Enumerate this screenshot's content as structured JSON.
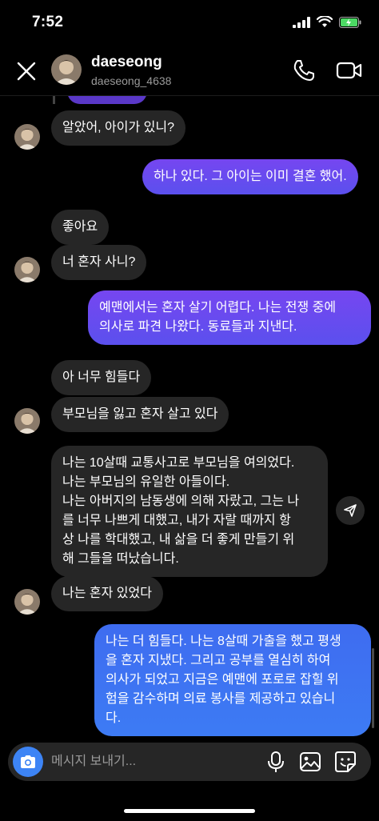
{
  "status_bar": {
    "time": "7:52"
  },
  "header": {
    "name": "daeseong",
    "username": "daeseong_4638"
  },
  "messages": [
    {
      "side": "received",
      "text": "알았어, 아이가 있니?"
    },
    {
      "side": "sent",
      "text": "하나 있다. 그 아이는 이미 결혼 했어."
    },
    {
      "side": "received",
      "text": "좋아요"
    },
    {
      "side": "received",
      "text": "너 혼자 사니?"
    },
    {
      "side": "sent",
      "text": "예맨에서는 혼자 살기 어렵다. 나는 전쟁 중에\n의사로 파견 나왔다. 동료들과 지낸다."
    },
    {
      "side": "received",
      "text": "아 너무 힘들다"
    },
    {
      "side": "received",
      "text": "부모님을 잃고 혼자 살고 있다"
    },
    {
      "side": "received",
      "text": "나는 10살때 교통사고로 부모님을 여의었다.\n나는 부모님의 유일한 아들이다.\n나는 아버지의 남동생에 의해 자랐고, 그는 나\n를 너무 나쁘게 대했고, 내가 자랄 때까지 항\n상 나를 학대했고, 내 삶을 더 좋게 만들기 위\n해 그들을 떠났습니다."
    },
    {
      "side": "received",
      "text": "나는 혼자 있었다"
    },
    {
      "side": "sent",
      "text": "나는 더 힘들다. 나는 8살때 가출을 했고 평생\n을 혼자 지냈다. 그리고 공부를 열심히 하여\n의사가 되었고 지금은 예맨에 포로로 잡힐 위\n험을 감수하며 의료 봉사를 제공하고 있습니\n다."
    }
  ],
  "composer": {
    "placeholder": "메시지 보내기..."
  },
  "colors": {
    "background": "#000000",
    "received_bubble": "#262626",
    "sent_bubble_purple": "#6a4cf0",
    "sent_bubble_blue": "#3d7bf4",
    "camera_button": "#3d84f5"
  },
  "icons": [
    "close-icon",
    "phone-icon",
    "video-camera-icon",
    "camera-icon",
    "microphone-icon",
    "gallery-icon",
    "sticker-icon",
    "send-arrow-icon"
  ]
}
